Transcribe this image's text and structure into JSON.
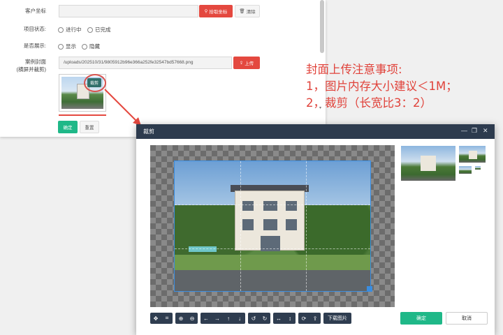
{
  "form": {
    "coord_label": "客户坐标",
    "coord_value": "",
    "pick_coord_label": "拾取坐标",
    "clear_label": "清除",
    "status_label": "项目状态:",
    "status_options": [
      "进行中",
      "已完成"
    ],
    "display_label": "是否展示:",
    "display_options": [
      "显示",
      "隐藏"
    ],
    "cover_label_line1": "案例封面",
    "cover_label_line2": "(横屏并裁剪)",
    "cover_path": "/uploads/202510/31/9805912b96e366a252fe32547bd57668.png",
    "upload_label": "上传",
    "crop_tag": "裁剪",
    "submit_label": "确定",
    "reset_label": "重置"
  },
  "annotation": {
    "line1": "封面上传注意事项:",
    "line2": "1，图片内存大小建议＜1M；",
    "line3": "2，裁剪（长宽比3：2）"
  },
  "dialog": {
    "title": "裁剪",
    "download_label": "下载图片",
    "confirm_label": "确定",
    "cancel_label": "取消",
    "toolbar_icons": [
      "move-icon",
      "crop-icon",
      "zoom-in-icon",
      "zoom-out-icon",
      "arrow-left-icon",
      "arrow-right-icon",
      "arrow-up-icon",
      "arrow-down-icon",
      "rotate-left-icon",
      "rotate-right-icon",
      "flip-horizontal-icon",
      "flip-vertical-icon",
      "refresh-icon",
      "upload-icon"
    ]
  },
  "colors": {
    "accent_red": "#e4483f",
    "accent_green": "#1fb888",
    "dialog_header": "#2d3b4e",
    "selection_blue": "#3a8de0"
  }
}
